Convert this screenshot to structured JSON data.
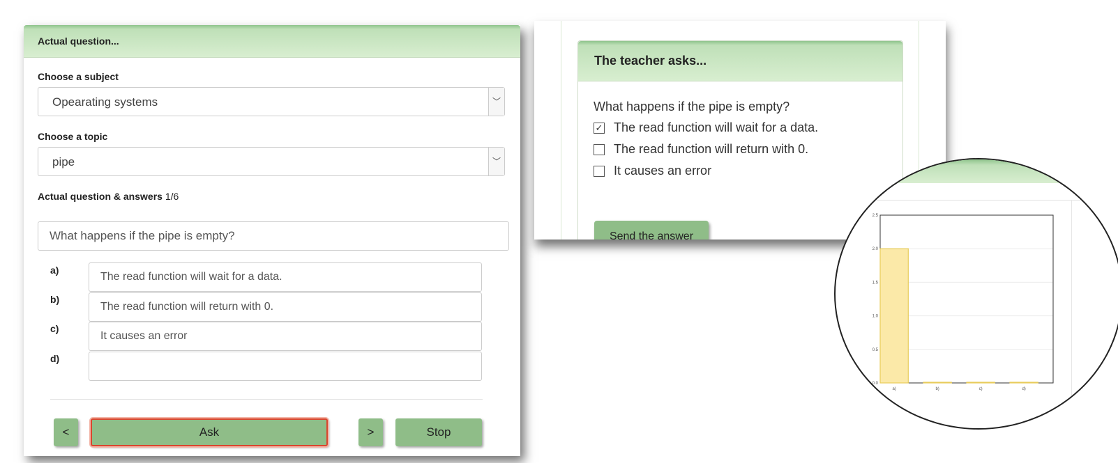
{
  "left_panel": {
    "header": "Actual question...",
    "subject_label": "Choose a subject",
    "subject_value": "Opearating systems",
    "topic_label": "Choose a topic",
    "topic_value": "pipe",
    "qa_label": "Actual question & answers",
    "qa_counter": "1/6",
    "question": "What happens if the pipe is empty?",
    "answers": [
      {
        "letter": "a)",
        "text": "The read function will wait for a data."
      },
      {
        "letter": "b)",
        "text": "The read function will return with 0."
      },
      {
        "letter": "c)",
        "text": "It causes an error"
      },
      {
        "letter": "d)",
        "text": ""
      }
    ],
    "buttons": {
      "prev": "<",
      "ask": "Ask",
      "next": ">",
      "stop": "Stop"
    }
  },
  "teacher_panel": {
    "header": "The teacher asks...",
    "question": "What happens if the pipe is empty?",
    "options": [
      {
        "text": "The read function will wait for a data.",
        "checked": true
      },
      {
        "text": "The read function will return with 0.",
        "checked": false
      },
      {
        "text": "It causes an error",
        "checked": false
      }
    ],
    "send_button": "Send the answer"
  },
  "colors": {
    "accent_green": "#8fbd88",
    "highlight_red": "#d9462e",
    "bar_fill": "#fbe9a8",
    "bar_stroke": "#e8cc5a"
  },
  "chart_data": {
    "type": "bar",
    "categories": [
      "a)",
      "b)",
      "c)",
      "d)"
    ],
    "values": [
      2,
      0,
      0,
      0
    ],
    "ylim": [
      0,
      2.5
    ],
    "yticks": [
      "0.0",
      "0.5",
      "1.0",
      "1.5",
      "2.0",
      "2.5"
    ],
    "grid": true
  }
}
